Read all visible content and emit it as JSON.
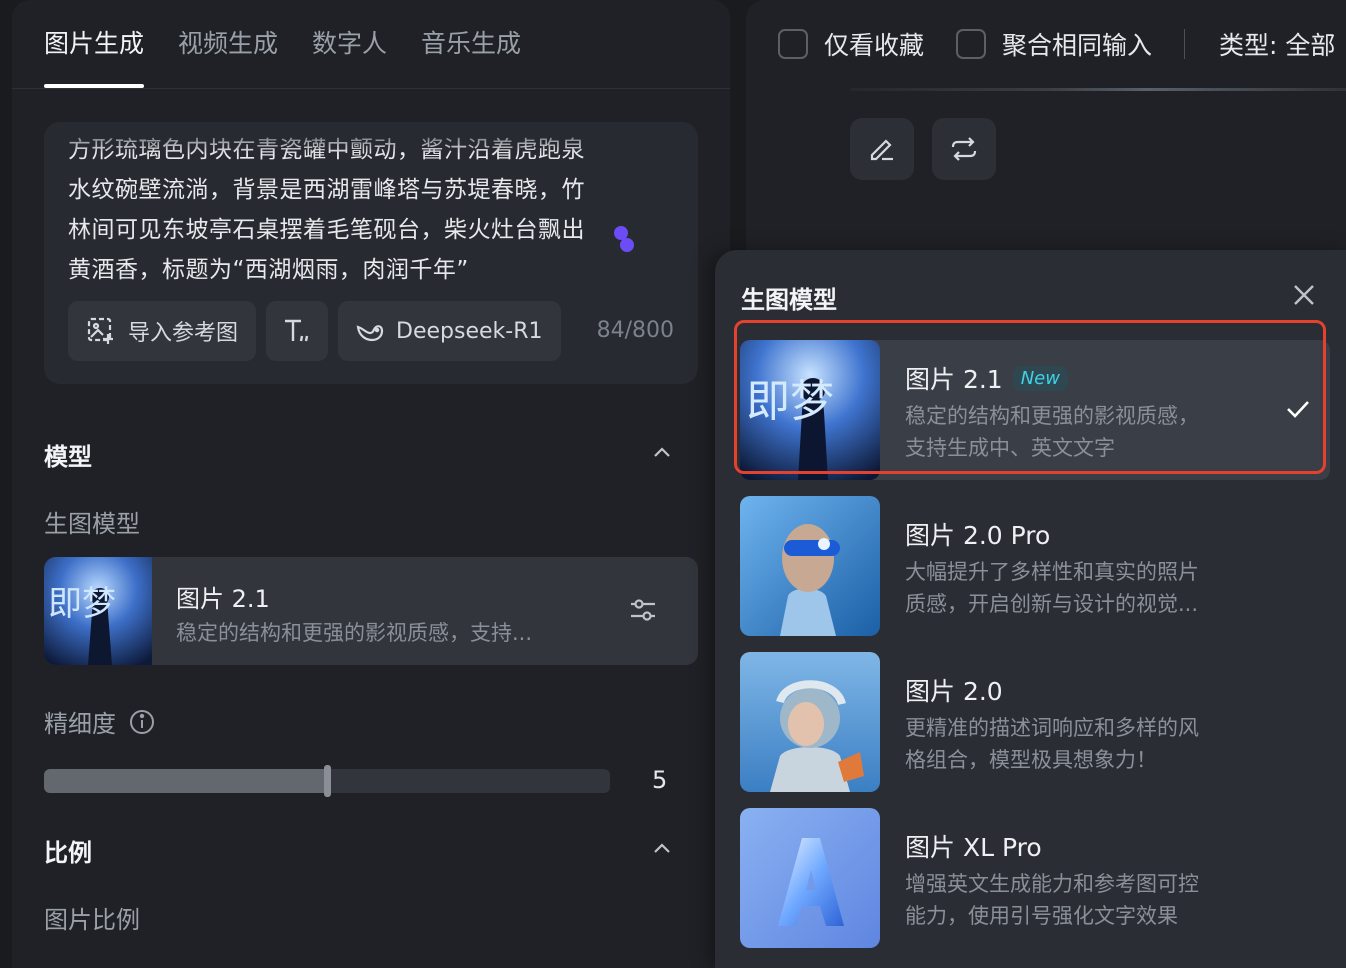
{
  "tabs": [
    {
      "label": "图片生成",
      "active": true
    },
    {
      "label": "视频生成",
      "active": false
    },
    {
      "label": "数字人",
      "active": false
    },
    {
      "label": "音乐生成",
      "active": false
    }
  ],
  "prompt": {
    "text": "方形琉璃色内块在青瓷罐中颤动，酱汁沿着虎跑泉\n水纹碗壁流淌，背景是西湖雷峰塔与苏堤春晓，竹\n林间可见东坡亭石桌摆着毛笔砚台，柴火灶台飘出\n黄酒香，标题为“西湖烟雨，肉润千年”",
    "import_ref_label": "导入参考图",
    "model_label": "Deepseek-R1",
    "counter": "84/800"
  },
  "model_section": {
    "title": "模型",
    "sub_label": "生图模型",
    "selected_name": "图片 2.1",
    "selected_desc": "稳定的结构和更强的影视质感，支持..."
  },
  "detail": {
    "label": "精细度",
    "value": "5",
    "fill_fraction": 0.5
  },
  "ratio_section": {
    "title": "比例",
    "sub_label": "图片比例"
  },
  "filters": {
    "favorites_label": "仅看收藏",
    "merge_label": "聚合相同输入",
    "type_label": "类型: 全部"
  },
  "popup": {
    "title": "生图模型",
    "options": [
      {
        "name": "图片 2.1",
        "badge": "New",
        "desc": "稳定的结构和更强的影视质感，\n支持生成中、英文文字",
        "selected": true
      },
      {
        "name": "图片 2.0 Pro",
        "badge": "",
        "desc": "大幅提升了多样性和真实的照片\n质感，开启创新与设计的视觉...",
        "selected": false
      },
      {
        "name": "图片 2.0",
        "badge": "",
        "desc": "更精准的描述词响应和多样的风\n格组合，模型极具想象力！",
        "selected": false
      },
      {
        "name": "图片 XL Pro",
        "badge": "",
        "desc": "增强英文生成能力和参考图可控\n能力，使用引号强化文字效果",
        "selected": false
      }
    ]
  },
  "thumb_text": "即梦",
  "colors": {
    "accent_purple": "#6b4cf6",
    "badge_cyan": "#3ed2e6",
    "highlight_red": "#e4412f"
  }
}
